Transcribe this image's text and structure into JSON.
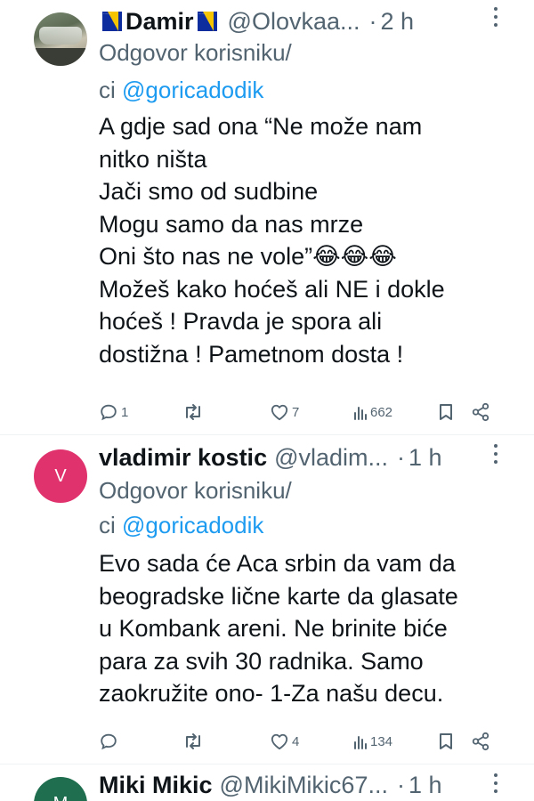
{
  "tweets": [
    {
      "name": "Damir",
      "has_flags": true,
      "handle": "@Olovkaa...",
      "separator": "·",
      "time": "2 h",
      "reply_prefix": "Odgovor korisniku/",
      "reply_ci": "ci",
      "reply_mention": "@goricadodik",
      "text": "A gdje sad ona “Ne može nam\nnitko ništa\nJači smo od sudbine\nMogu samo da nas mrze\nOni što nas ne vole”😂😂😂\nMožeš kako hoćeš ali NE i dokle\nhoćeš ! Pravda je spora ali\ndostižna ! Pametnom dosta !",
      "replies": "1",
      "retweets": "",
      "likes": "7",
      "views": "662",
      "avatar": "photo"
    },
    {
      "name": "vladimir kostic",
      "has_flags": false,
      "handle": "@vladim...",
      "separator": "·",
      "time": "1 h",
      "reply_prefix": "Odgovor korisniku/",
      "reply_ci": "ci",
      "reply_mention": "@goricadodik",
      "text": "Evo sada će Aca srbin da vam da\nbeogradske lične karte da glasate\nu Kombank areni. Ne brinite biće\npara za svih 30 radnika. Samo\nzaokružite ono- 1-Za našu decu.",
      "replies": "",
      "retweets": "",
      "likes": "4",
      "views": "134",
      "avatar": "letter",
      "avatar_letter": "V",
      "avatar_color": "#e0336d"
    },
    {
      "name": "Miki Mikic",
      "has_flags": false,
      "handle": "@MikiMikic67...",
      "separator": "·",
      "time": "1 h",
      "avatar": "letter",
      "avatar_letter": "M",
      "avatar_color": "#1e6e4f"
    }
  ],
  "icons": {
    "reply": "reply-icon",
    "retweet": "retweet-icon",
    "like": "heart-icon",
    "views": "views-icon",
    "bookmark": "bookmark-icon",
    "share": "share-icon",
    "more": "more-icon"
  },
  "colors": {
    "text": "#0f1419",
    "secondary": "#536471",
    "link": "#1d9bf0",
    "divider": "#eff3f4"
  }
}
